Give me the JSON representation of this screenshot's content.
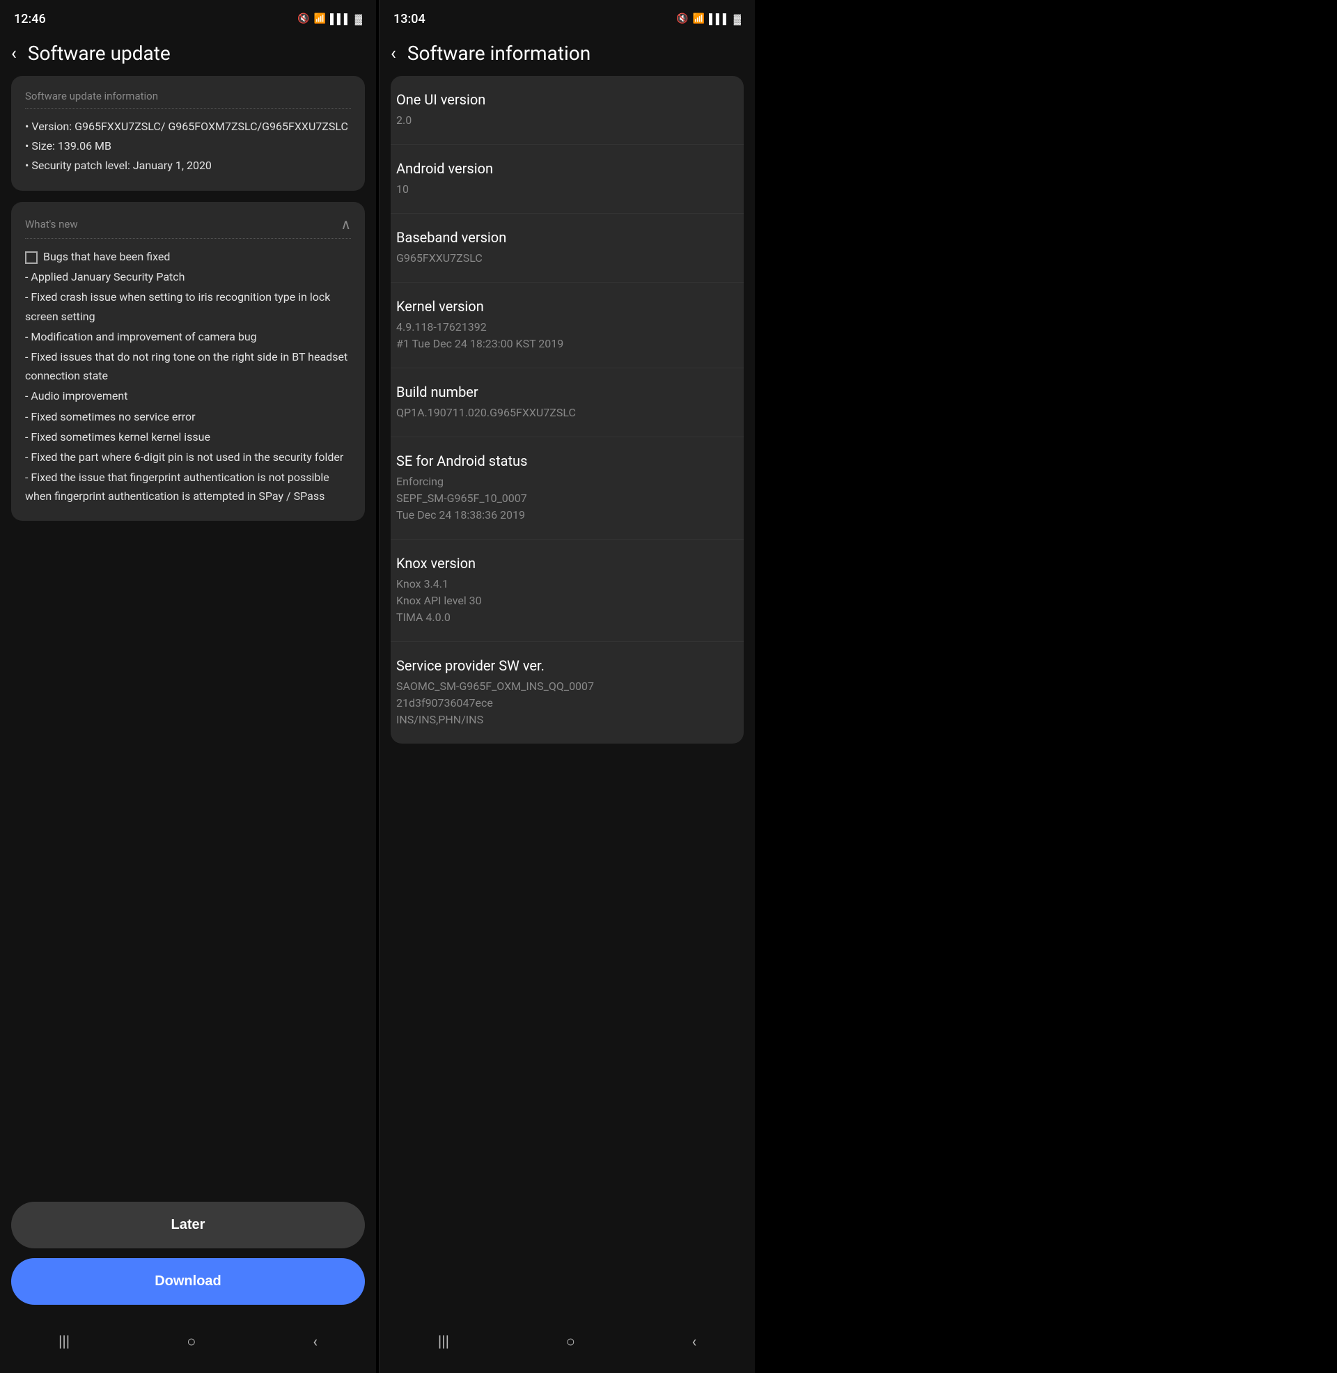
{
  "left_screen": {
    "status_bar": {
      "time": "12:46",
      "icons": "🔇 📶 📶 🔋"
    },
    "nav": {
      "back_icon": "‹",
      "title": "Software update"
    },
    "update_info": {
      "section_title": "Software update information",
      "version_label": "• Version: G965FXXU7ZSLC/ G965FOXM7ZSLC/G965FXXU7ZSLC",
      "size_label": "• Size: 139.06 MB",
      "security_label": "• Security patch level: January 1, 2020"
    },
    "whats_new": {
      "title": "What's new",
      "changelog": [
        "☐ Bugs that have been fixed",
        " - Applied January Security Patch",
        " - Fixed crash issue when setting to iris recognition type in lock screen setting",
        " - Modification and improvement of camera bug",
        " - Fixed issues that do not ring tone on the right side in BT headset connection state",
        " - Audio improvement",
        " - Fixed sometimes no service error",
        " - Fixed sometimes kernel kernel issue",
        " - Fixed the part where 6-digit pin is not used in the security folder",
        " - Fixed the issue that fingerprint authentication is not possible when fingerprint authentication is attempted in SPay / SPass"
      ]
    },
    "buttons": {
      "later": "Later",
      "download": "Download"
    },
    "bottom_nav": {
      "menu_icon": "|||",
      "home_icon": "○",
      "back_icon": "‹"
    }
  },
  "right_screen": {
    "status_bar": {
      "time": "13:04",
      "icons": "🔇 📶 📶 🔋"
    },
    "nav": {
      "back_icon": "‹",
      "title": "Software information"
    },
    "info_items": [
      {
        "label": "One UI version",
        "value": "2.0"
      },
      {
        "label": "Android version",
        "value": "10"
      },
      {
        "label": "Baseband version",
        "value": "G965FXXU7ZSLC"
      },
      {
        "label": "Kernel version",
        "value": "4.9.118-17621392\n#1 Tue Dec 24 18:23:00 KST 2019"
      },
      {
        "label": "Build number",
        "value": "QP1A.190711.020.G965FXXU7ZSLC"
      },
      {
        "label": "SE for Android status",
        "value": "Enforcing\nSEPF_SM-G965F_10_0007\nTue Dec 24 18:38:36 2019"
      },
      {
        "label": "Knox version",
        "value": "Knox 3.4.1\nKnox API level 30\nTIMA 4.0.0"
      },
      {
        "label": "Service provider SW ver.",
        "value": "SAOMC_SM-G965F_OXM_INS_QQ_0007\n21d3f90736047ece\nINS/INS,PHN/INS"
      }
    ],
    "bottom_nav": {
      "menu_icon": "|||",
      "home_icon": "○",
      "back_icon": "‹"
    }
  }
}
